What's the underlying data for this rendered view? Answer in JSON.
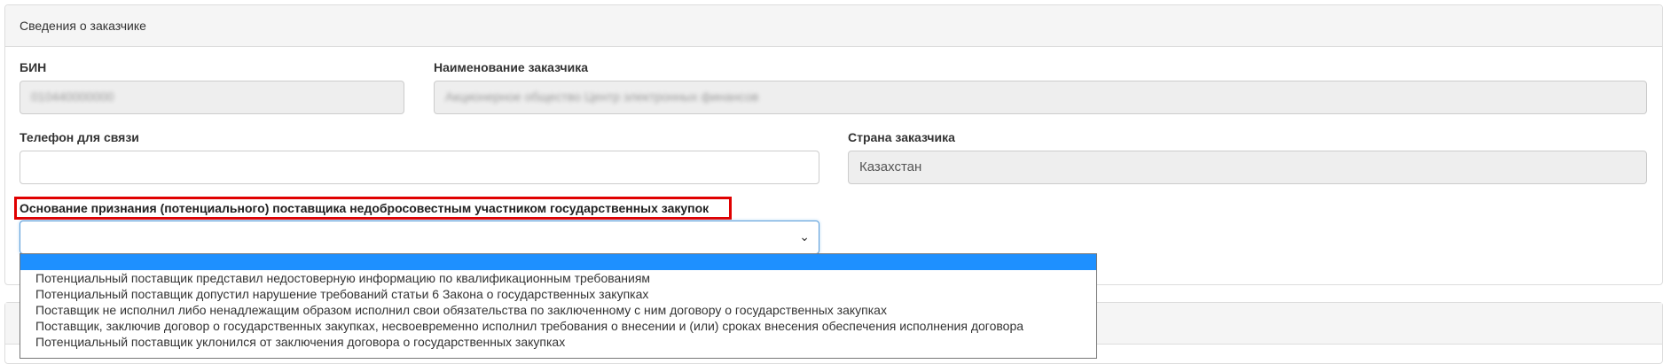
{
  "panel": {
    "title": "Сведения о заказчике"
  },
  "fields": {
    "bin": {
      "label": "БИН",
      "value": "010440000000"
    },
    "customer_name": {
      "label": "Наименование заказчика",
      "value": "Акционерное общество Центр электронных финансов"
    },
    "phone": {
      "label": "Телефон для связи",
      "value": ""
    },
    "country": {
      "label": "Страна заказчика",
      "value": "Казахстан"
    }
  },
  "basis": {
    "label": "Основание признания (потенциального) поставщика недобросовестным участником государственных закупок",
    "selected_value": "",
    "options": [
      "",
      "Потенциальный поставщик представил недостоверную информацию по квалификационным требованиям",
      "Потенциальный поставщик допустил нарушение требований статьи 6 Закона о государственных закупках",
      "Поставщик не исполнил либо ненадлежащим образом исполнил свои обязательства по заключенному с ним договору о государственных закупках",
      "Поставщик, заключив договор о государственных закупках, несвоевременно исполнил требования о внесении и (или) сроках внесения обеспечения исполнения договора",
      "Потенциальный поставщик уклонился от заключения договора о государственных закупках"
    ]
  },
  "colors": {
    "highlight_border": "#e00000",
    "selected_option": "#1e90ff"
  }
}
